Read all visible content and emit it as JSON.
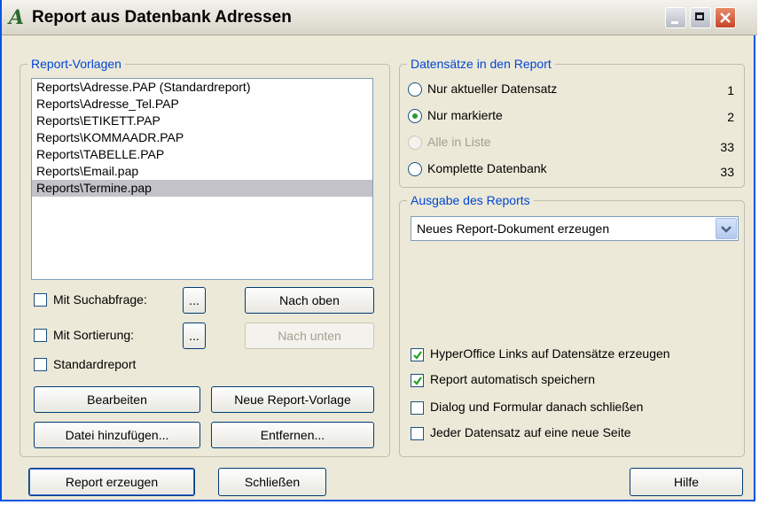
{
  "window": {
    "title": "Report aus Datenbank Adressen"
  },
  "templates": {
    "legend": "Report-Vorlagen",
    "items": [
      "Reports\\Adresse.PAP (Standardreport)",
      "Reports\\Adresse_Tel.PAP",
      "Reports\\ETIKETT.PAP",
      "Reports\\KOMMAADR.PAP",
      "Reports\\TABELLE.PAP",
      "Reports\\Email.pap",
      "Reports\\Termine.pap"
    ],
    "selected_index": 6,
    "mit_suchabfrage": "Mit Suchabfrage:",
    "mit_sortierung": "Mit Sortierung:",
    "standardreport": "Standardreport",
    "ellipsis": "...",
    "nach_oben": "Nach oben",
    "nach_unten": "Nach unten",
    "bearbeiten": "Bearbeiten",
    "neue_vorlage": "Neue Report-Vorlage",
    "datei_hinzufuegen": "Datei hinzufügen...",
    "entfernen": "Entfernen..."
  },
  "records": {
    "legend": "Datensätze in den Report",
    "options": [
      {
        "label": "Nur aktueller Datensatz",
        "count": "1"
      },
      {
        "label": "Nur markierte",
        "count": "2"
      },
      {
        "label": "Alle in Liste",
        "count": "33"
      },
      {
        "label": "Komplette Datenbank",
        "count": "33"
      }
    ],
    "selected_index": 1
  },
  "output": {
    "legend": "Ausgabe des Reports",
    "select_value": "Neues Report-Dokument erzeugen",
    "options": [
      {
        "label": "HyperOffice Links auf Datensätze erzeugen",
        "checked": true
      },
      {
        "label": "Report automatisch speichern",
        "checked": true
      },
      {
        "label": "Dialog und Formular danach schließen",
        "checked": false
      },
      {
        "label": "Jeder Datensatz auf eine neue Seite",
        "checked": false
      }
    ]
  },
  "footer": {
    "report_erzeugen": "Report erzeugen",
    "schliessen": "Schließen",
    "hilfe": "Hilfe"
  }
}
